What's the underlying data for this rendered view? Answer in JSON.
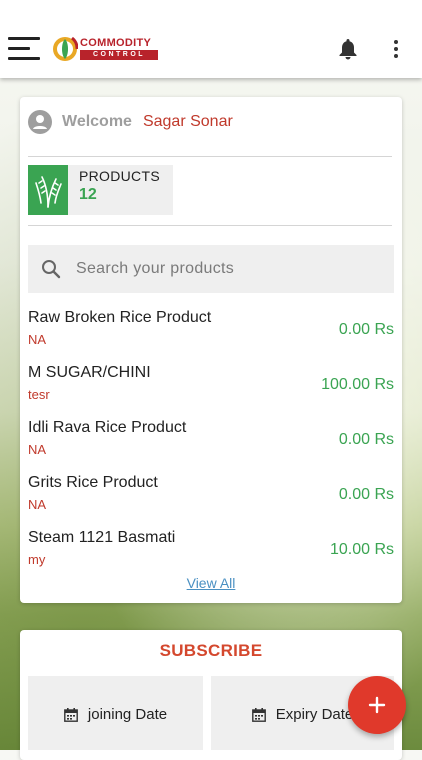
{
  "app": {
    "logo_line1": "COMMODITY",
    "logo_line2": "CONTROL"
  },
  "welcome": {
    "label": "Welcome",
    "name": "Sagar Sonar"
  },
  "products_summary": {
    "label": "PRODUCTS",
    "count": "12"
  },
  "search": {
    "placeholder": "Search your products",
    "value": ""
  },
  "products": [
    {
      "name": "Raw Broken Rice Product",
      "sub": "NA",
      "price": "0.00 Rs"
    },
    {
      "name": "M SUGAR/CHINI",
      "sub": "tesr",
      "price": "100.00 Rs"
    },
    {
      "name": "Idli Rava Rice Product",
      "sub": "NA",
      "price": "0.00 Rs"
    },
    {
      "name": "Grits Rice Product",
      "sub": "NA",
      "price": "0.00 Rs"
    },
    {
      "name": "Steam 1121 Basmati",
      "sub": "my",
      "price": "10.00 Rs"
    }
  ],
  "view_all": "View All",
  "subscribe": {
    "title": "SUBSCRIBE",
    "joining_label": "joining Date",
    "expiry_label": "Expiry Date"
  },
  "icons": {
    "menu": "hamburger-menu-icon",
    "notifications": "bell-icon",
    "more": "kebab-menu-icon",
    "user": "user-avatar-icon",
    "products": "wheat-icon",
    "search": "search-icon",
    "calendar": "calendar-icon",
    "add": "plus-icon"
  },
  "colors": {
    "accent_green": "#3aa452",
    "accent_red": "#c0392b",
    "subscribe_red": "#d4482e",
    "fab_red": "#e0392b",
    "link_blue": "#4a90c2"
  }
}
